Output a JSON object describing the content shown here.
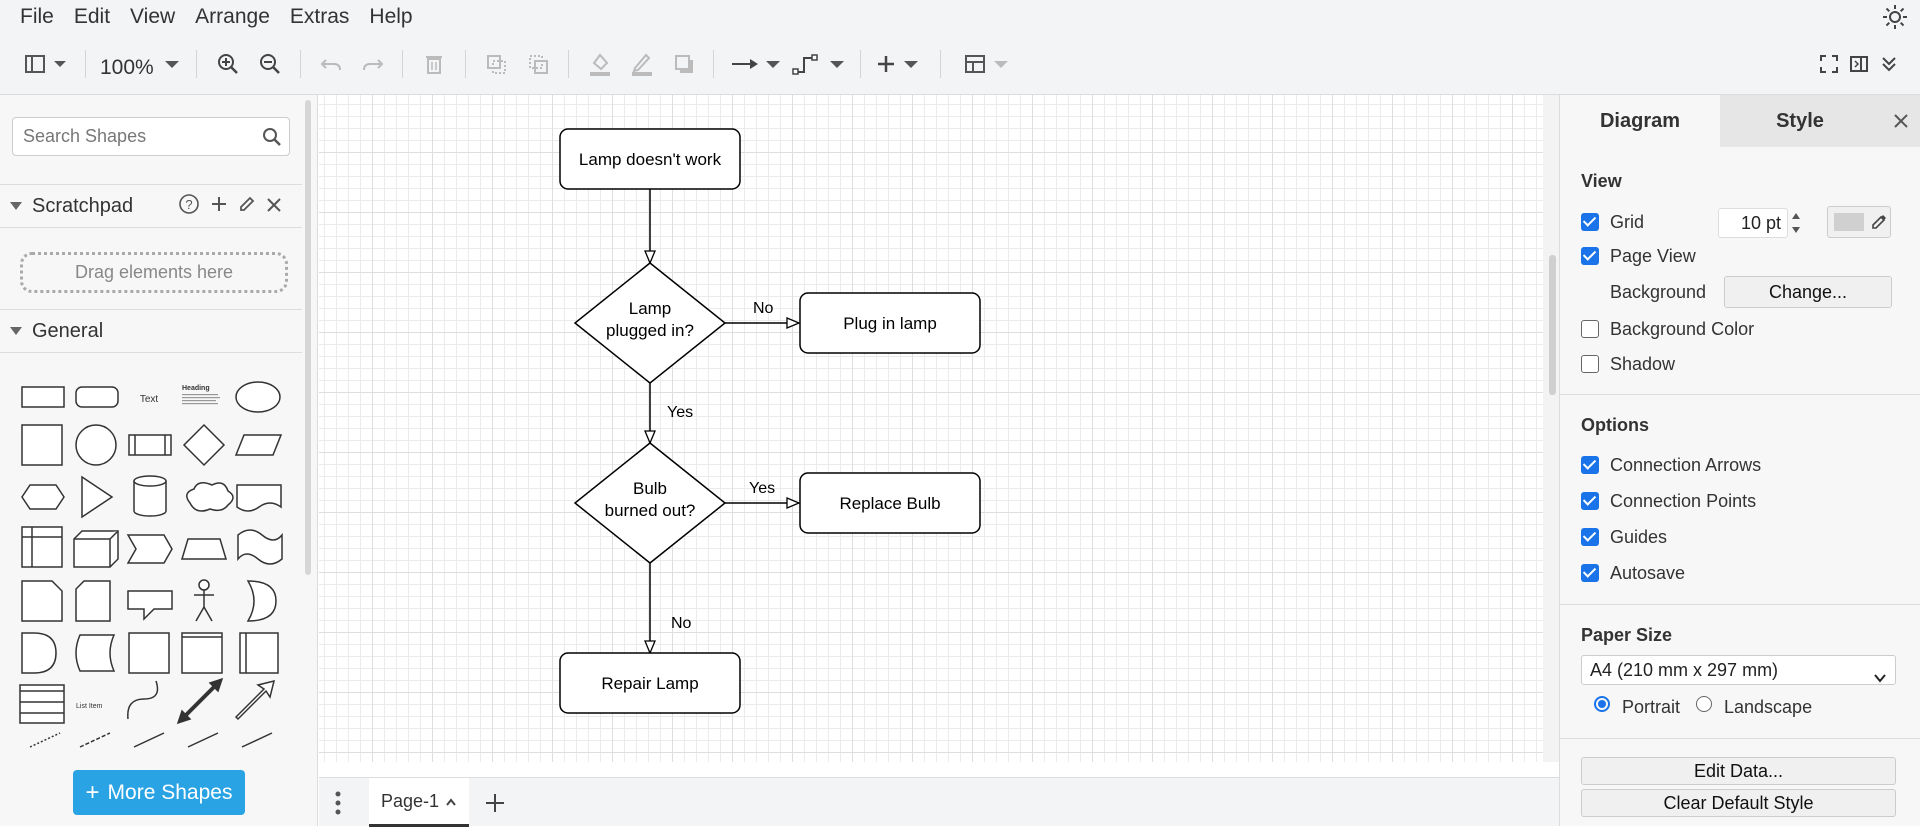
{
  "menu": [
    "File",
    "Edit",
    "View",
    "Arrange",
    "Extras",
    "Help"
  ],
  "toolbar": {
    "zoom": "100%"
  },
  "sidebar": {
    "search_placeholder": "Search Shapes",
    "scratchpad_title": "Scratchpad",
    "drag_hint": "Drag elements here",
    "general_title": "General",
    "more_shapes": "More Shapes",
    "shape_text_label": "Text",
    "shape_heading_label": "Heading",
    "shape_list_item_label": "List Item"
  },
  "diagram": {
    "start": "Lamp doesn't work",
    "decision1_line1": "Lamp",
    "decision1_line2": "plugged in?",
    "action1": "Plug in lamp",
    "decision2_line1": "Bulb",
    "decision2_line2": "burned out?",
    "action2": "Replace Bulb",
    "action3": "Repair Lamp",
    "edge_no1": "No",
    "edge_yes1": "Yes",
    "edge_yes2": "Yes",
    "edge_no2": "No"
  },
  "tabs": {
    "page": "Page-1"
  },
  "panel": {
    "tab_diagram": "Diagram",
    "tab_style": "Style",
    "view_heading": "View",
    "grid_label": "Grid",
    "grid_size": "10 pt",
    "page_view_label": "Page View",
    "background_label": "Background",
    "change_button": "Change...",
    "background_color_label": "Background Color",
    "shadow_label": "Shadow",
    "options_heading": "Options",
    "connection_arrows": "Connection Arrows",
    "connection_points": "Connection Points",
    "guides": "Guides",
    "autosave": "Autosave",
    "paper_size_heading": "Paper Size",
    "paper_size_value": "A4 (210 mm x 297 mm)",
    "portrait": "Portrait",
    "landscape": "Landscape",
    "edit_data": "Edit Data...",
    "clear_default_style": "Clear Default Style"
  }
}
